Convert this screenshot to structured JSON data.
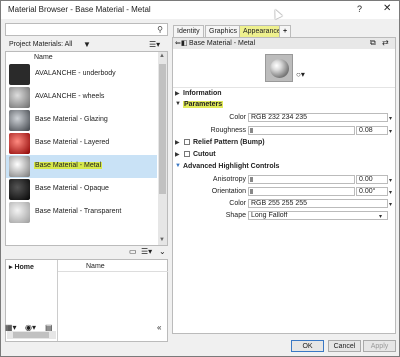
{
  "window": {
    "title": "Material Browser - Base Material - Metal",
    "help_label": "?",
    "close_label": "✕"
  },
  "left": {
    "search_placeholder": "",
    "header_label": "Project Materials: All",
    "filter_icon": "▼",
    "view_icon": "☰▾",
    "column_name": "Name",
    "materials": [
      {
        "label": "AVALANCHE - underbody",
        "color": "#2a2a2a"
      },
      {
        "label": "AVALANCHE - wheels",
        "color": "#808080"
      },
      {
        "label": "Base Material - Glazing",
        "color": "#5a6068"
      },
      {
        "label": "Base Material - Layered",
        "color": "#b71c1c"
      },
      {
        "label": "Base Material - Metal",
        "color": "#9a9a9a"
      },
      {
        "label": "Base Material - Opaque",
        "color": "#141414"
      },
      {
        "label": "Base Material - Transparent",
        "color": "#d0d0d0"
      }
    ],
    "selected_index": 4,
    "library": {
      "home_label": "Home",
      "name_column": "Name"
    },
    "collapse_label": "«"
  },
  "right": {
    "tabs": [
      "Identity",
      "Graphics",
      "Appearance",
      "+"
    ],
    "active_tab": 2,
    "header_title": "Base Material - Metal",
    "sections": {
      "information": "Information",
      "parameters": "Parameters",
      "relief": "Relief Pattern (Bump)",
      "cutout": "Cutout",
      "highlight": "Advanced Highlight Controls"
    },
    "parameters": {
      "color_label": "Color",
      "color_value": "RGB 232 234 235",
      "roughness_label": "Roughness",
      "roughness_value": "0.08"
    },
    "highlight": {
      "anisotropy_label": "Anisotropy",
      "anisotropy_value": "0.00",
      "orientation_label": "Orientation",
      "orientation_value": "0.00°",
      "color_label": "Color",
      "color_value": "RGB 255 255 255",
      "shape_label": "Shape",
      "shape_value": "Long Falloff"
    }
  },
  "buttons": {
    "ok": "OK",
    "cancel": "Cancel",
    "apply": "Apply"
  },
  "colors": {
    "selection": "#c9e2f6",
    "highlight": "#e2eb5a"
  }
}
